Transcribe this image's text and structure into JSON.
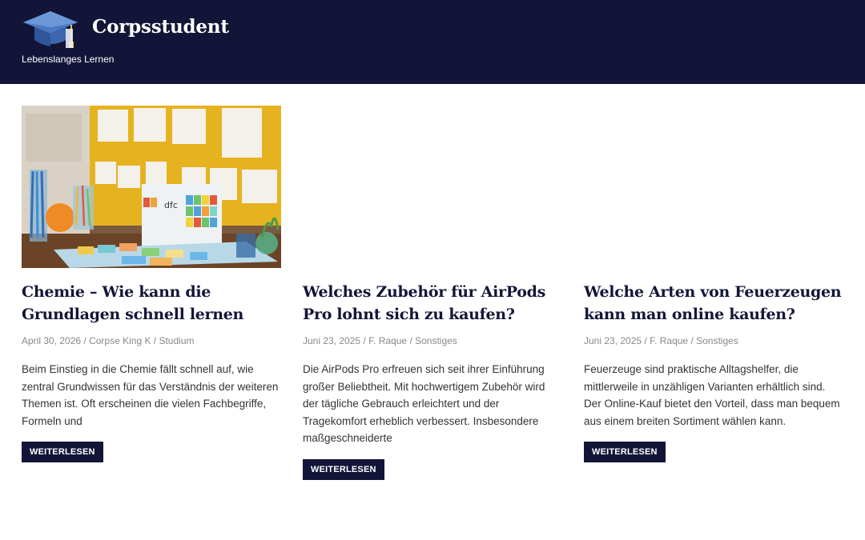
{
  "site": {
    "title": "Corpsstudent",
    "tagline": "Lebenslanges Lernen",
    "logo_icon": "graduation-cap-icon",
    "header_color": "#131538"
  },
  "posts": [
    {
      "title": "Chemie – Wie kann die Grundlagen schnell lernen",
      "date": "April 30, 2026",
      "author": "Corpse King K",
      "category": "Studium",
      "excerpt": "Beim Einstieg in die Chemie fällt schnell auf, wie zentral Grundwissen für das Verständnis der weiteren Themen ist. Oft erscheinen die vielen Fachbegriffe, Formeln und",
      "button": "WEITERLESEN",
      "image_text": "dfc"
    },
    {
      "title": "Welches Zubehör für AirPods Pro lohnt sich zu kaufen?",
      "date": "Juni 23, 2025",
      "author": "F. Raque",
      "category": "Sonstiges",
      "excerpt": "Die AirPods Pro erfreuen sich seit ihrer Einführung großer Beliebtheit. Mit hochwertigem Zubehör wird der tägliche Gebrauch erleichtert und der Tragekomfort erheblich verbessert. Insbesondere maßgeschneiderte",
      "button": "WEITERLESEN"
    },
    {
      "title": "Welche Arten von Feuerzeugen kann man online kaufen?",
      "date": "Juni 23, 2025",
      "author": "F. Raque",
      "category": "Sonstiges",
      "excerpt": "Feuerzeuge sind praktische Alltagshelfer, die mittlerweile in unzähligen Varianten erhältlich sind. Der Online-Kauf bietet den Vorteil, dass man bequem aus einem breiten Sortiment wählen kann.",
      "button": "WEITERLESEN"
    }
  ],
  "separator": "/"
}
